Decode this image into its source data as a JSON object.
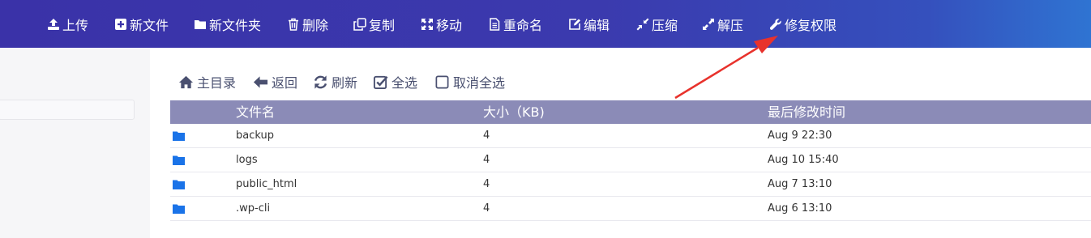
{
  "toolbar": {
    "items": [
      {
        "label": "上传",
        "icon": "upload-icon"
      },
      {
        "label": "新文件",
        "icon": "plus-square-icon"
      },
      {
        "label": "新文件夹",
        "icon": "folder-icon"
      },
      {
        "label": "删除",
        "icon": "trash-icon"
      },
      {
        "label": "复制",
        "icon": "copy-icon"
      },
      {
        "label": "移动",
        "icon": "move-icon"
      },
      {
        "label": "重命名",
        "icon": "file-text-icon"
      },
      {
        "label": "编辑",
        "icon": "edit-icon"
      },
      {
        "label": "压缩",
        "icon": "compress-icon"
      },
      {
        "label": "解压",
        "icon": "expand-icon"
      },
      {
        "label": "修复权限",
        "icon": "wrench-icon"
      }
    ]
  },
  "actions": {
    "home": "主目录",
    "back": "返回",
    "refresh": "刷新",
    "select_all": "全选",
    "deselect_all": "取消全选"
  },
  "table": {
    "headers": {
      "name": "文件名",
      "size": "大小（KB)",
      "modified": "最后修改时间"
    },
    "rows": [
      {
        "name": "backup",
        "size": "4",
        "modified": "Aug 9 22:30"
      },
      {
        "name": "logs",
        "size": "4",
        "modified": "Aug 10 15:40"
      },
      {
        "name": "public_html",
        "size": "4",
        "modified": "Aug 7 13:10"
      },
      {
        "name": ".wp-cli",
        "size": "4",
        "modified": "Aug 6 13:10"
      }
    ]
  },
  "colors": {
    "toolbar_start": "#3a32a8",
    "toolbar_end": "#2f74d2",
    "table_header": "#8b8bb7",
    "folder_icon": "#1a73e8",
    "annotation_arrow": "#e8322c"
  }
}
